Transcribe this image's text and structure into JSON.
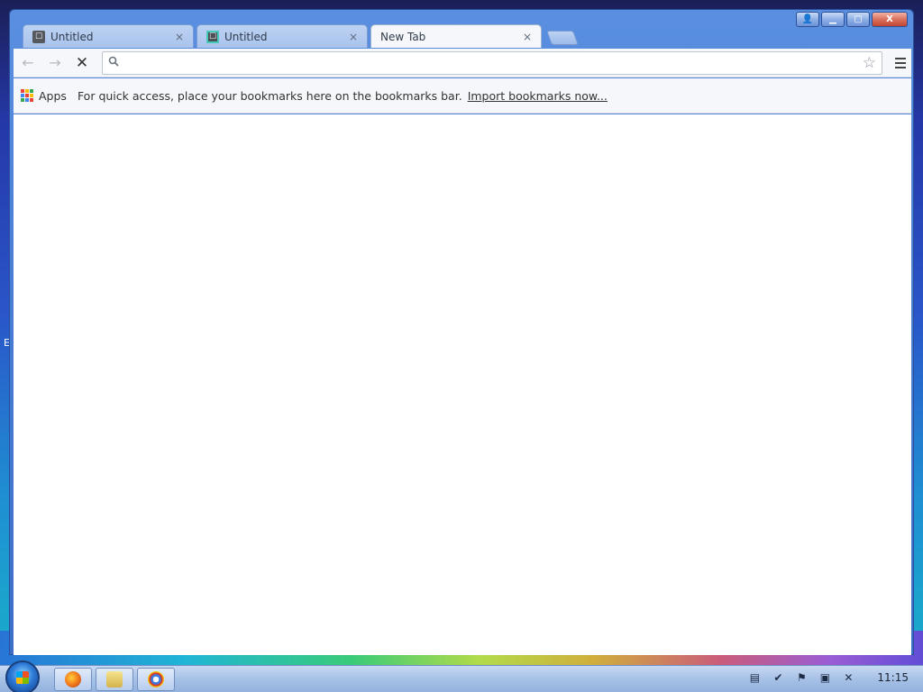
{
  "tabs": [
    {
      "title": "Untitled",
      "close": "×"
    },
    {
      "title": "Untitled",
      "close": "×"
    },
    {
      "title": "New Tab",
      "close": "×"
    }
  ],
  "toolbar": {
    "back_icon": "arrow-left-icon",
    "forward_icon": "arrow-right-icon",
    "stop_label": "✕",
    "omnibox_value": "",
    "omnibox_placeholder": "",
    "star_glyph": "☆"
  },
  "bookmarks_bar": {
    "apps_label": "Apps",
    "hint": "For quick access, place your bookmarks here on the bookmarks bar.",
    "import_link": "Import bookmarks now..."
  },
  "window_controls": {
    "minimize": "▁",
    "maximize": "▢",
    "close": "X"
  },
  "desktop": {
    "edge_letter": "E"
  },
  "taskbar": {
    "clock": "11:15",
    "pinned": [
      "firefox-icon",
      "explorer-icon",
      "chrome-icon"
    ]
  },
  "colors": {
    "window_frame": "#4b7fd6",
    "active_tab": "#f5f7fa",
    "inactive_tab": "#a9c3ec"
  }
}
